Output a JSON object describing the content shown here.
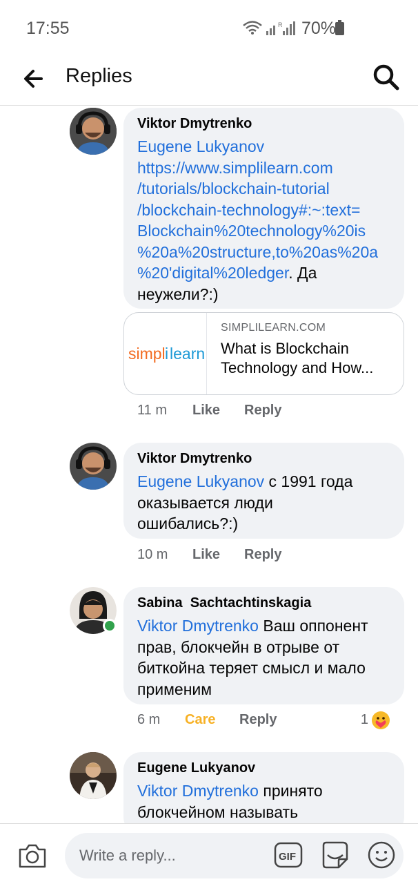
{
  "status": {
    "time": "17:55",
    "battery": "70%"
  },
  "header": {
    "title": "Replies"
  },
  "comments": [
    {
      "author": "Viktor Dmytrenko",
      "mention": "Eugene Lukyanov",
      "link_lines": [
        "https://www.simplilearn.com",
        "/tutorials/blockchain-tutorial",
        "/blockchain-technology#:~:text=",
        "Blockchain%20technology%20is",
        "%20a%20structure,to%20as%20a",
        "%20'digital%20ledger"
      ],
      "text_after_link": ". Да",
      "text_line2": "неужели?:)",
      "link_card": {
        "domain": "SIMPLILEARN.COM",
        "title": "What is Blockchain Technology and How...",
        "logo_text": "simplilearn"
      },
      "time": "11 m",
      "like": "Like",
      "reply": "Reply"
    },
    {
      "author": "Viktor Dmytrenko",
      "mention": "Eugene Lukyanov",
      "text_first": " с 1991 года",
      "text_rest": [
        "оказывается люди",
        "ошибались?:)"
      ],
      "time": "10 m",
      "like": "Like",
      "reply": "Reply"
    },
    {
      "author": "Sabina  Sachtachtinskagia",
      "mention": "Viktor Dmytrenko",
      "text_first": " Ваш оппонент",
      "text_rest": [
        "прав, блокчейн в отрыве от",
        "биткойна теряет смысл и мало",
        "применим"
      ],
      "time": "6 m",
      "reaction": "Care",
      "reply": "Reply",
      "reaction_count": "1"
    },
    {
      "author": "Eugene Lukyanov",
      "mention": "Viktor Dmytrenko",
      "text_first": " принято",
      "text_rest": [
        "блокчейном называть"
      ]
    }
  ],
  "composer": {
    "placeholder": "Write a reply..."
  },
  "colors": {
    "link": "#216fdb",
    "bubble": "#f0f2f5",
    "care": "#f7b125",
    "online": "#31a24c"
  }
}
